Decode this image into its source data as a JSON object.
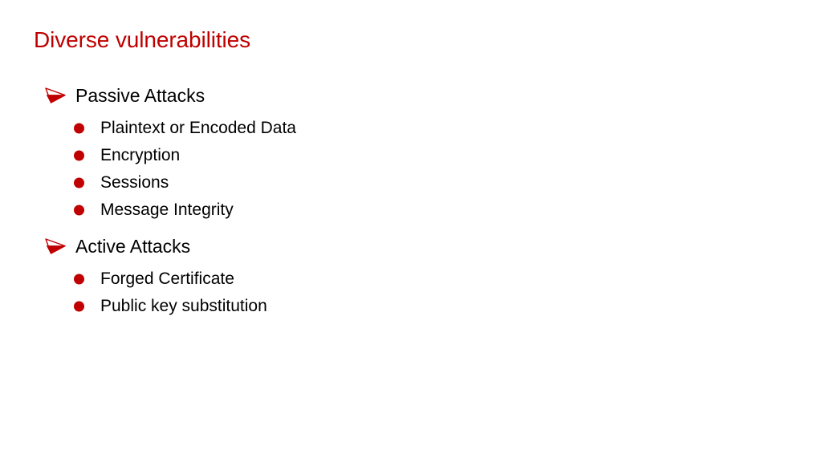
{
  "slide": {
    "title": "Diverse vulnerabilities",
    "background_color": "#FFFFFF",
    "title_color": "#C00000",
    "body_text_color": "#000000",
    "bullet_color": "#C00000",
    "level1_bullet_icon": "arrowhead-bullet-icon",
    "level2_bullet_icon": "disc-bullet-icon",
    "groups": [
      {
        "label": "Passive Attacks",
        "items": [
          "Plaintext or Encoded Data",
          "Encryption",
          "Sessions",
          "Message Integrity"
        ]
      },
      {
        "label": "Active Attacks",
        "items": [
          "Forged Certificate",
          "Public key substitution"
        ]
      }
    ]
  }
}
